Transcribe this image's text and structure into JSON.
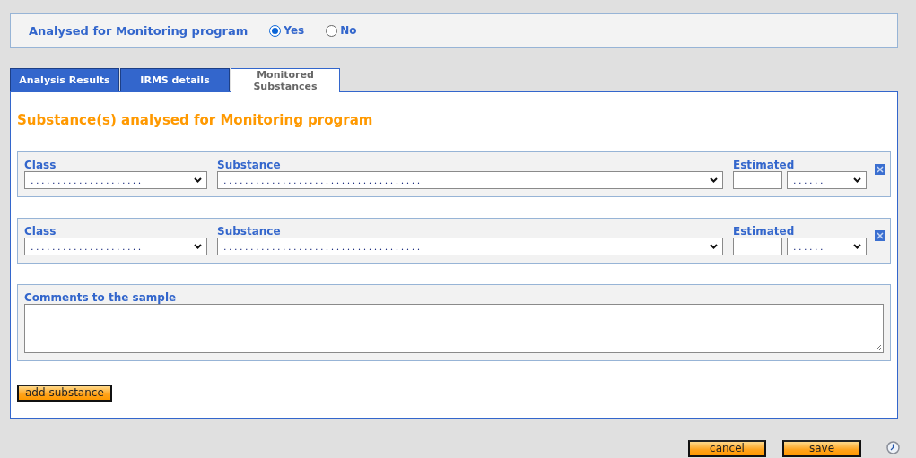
{
  "monitoring": {
    "label": "Analysed for Monitoring program",
    "options": [
      {
        "label": "Yes",
        "selected": true
      },
      {
        "label": "No",
        "selected": false
      }
    ]
  },
  "tabs": [
    {
      "label": "Analysis Results",
      "selected": false
    },
    {
      "label": "IRMS details",
      "selected": false
    },
    {
      "label": "Monitored Substances",
      "selected": true
    }
  ],
  "section_title": "Substance(s) analysed for Monitoring program",
  "substance_rows": [
    {
      "class_label": "Class",
      "class_value": ". . . . . . . . . . . . . . . . . . . . .",
      "substance_label": "Substance",
      "substance_value": ". . . . . . . . . . . . . . . . . . . . . . . . . . . . . . . . . . . . .",
      "estimated_label": "Estimated",
      "unit_value": ". . . . . ."
    },
    {
      "class_label": "Class",
      "class_value": ". . . . . . . . . . . . . . . . . . . . .",
      "substance_label": "Substance",
      "substance_value": ". . . . . . . . . . . . . . . . . . . . . . . . . . . . . . . . . . . . .",
      "estimated_label": "Estimated",
      "unit_value": ". . . . . ."
    }
  ],
  "comments": {
    "label": "Comments to the sample"
  },
  "buttons": {
    "add": "add substance",
    "cancel": "cancel",
    "save": "save"
  }
}
